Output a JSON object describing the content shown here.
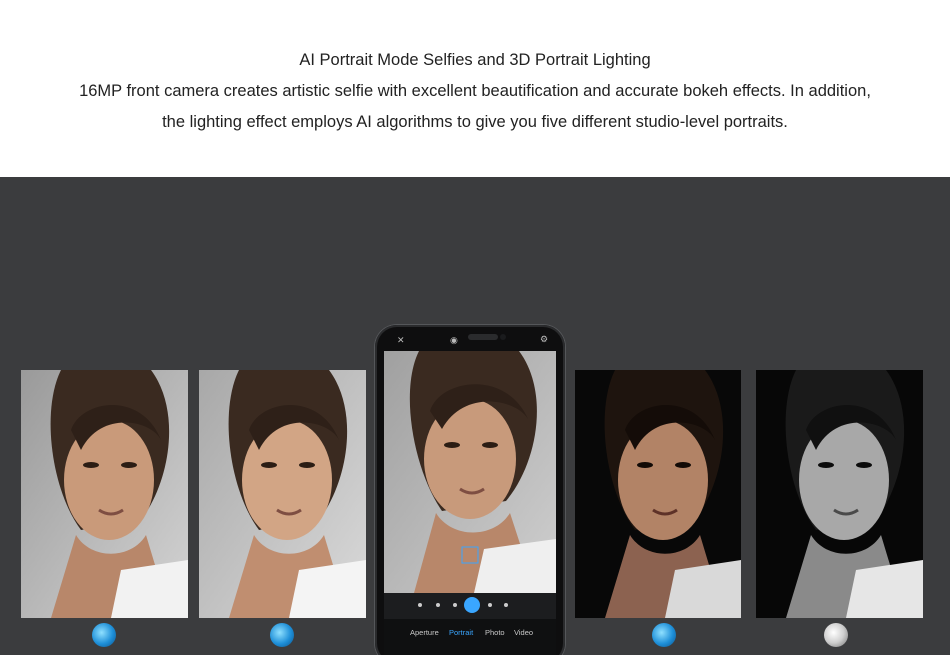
{
  "header": {
    "title": "AI Portrait Mode Selfies and 3D Portrait Lighting",
    "line1": "16MP front camera creates artistic selfie with excellent beautification and accurate bokeh effects. In addition,",
    "line2": "the lighting effect employs AI algorithms to give you five different studio-level portraits."
  },
  "phone": {
    "modes": [
      "Aperture",
      "Portrait",
      "Photo",
      "Video"
    ],
    "active_mode": "Portrait",
    "icons": [
      "flash-off-icon",
      "beauty-icon",
      "settings-icon"
    ]
  },
  "photos": [
    {
      "name": "portrait-soft-light",
      "style": "light"
    },
    {
      "name": "portrait-butterfly-light",
      "style": "light"
    },
    {
      "name": "portrait-phone-preview",
      "style": "light"
    },
    {
      "name": "portrait-stage-light",
      "style": "dark"
    },
    {
      "name": "portrait-classic-mono",
      "style": "mono"
    }
  ],
  "colors": {
    "stage_bg": "#3b3c3e",
    "accent": "#3aa6ff",
    "icon_blue": "#1e8fd8"
  }
}
